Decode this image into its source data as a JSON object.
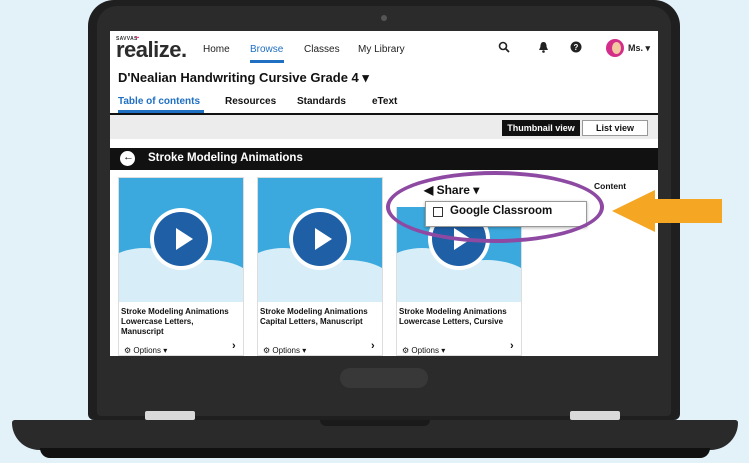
{
  "app": {
    "brand_small": "SAVVAS",
    "brand_dots": "▪▪▪",
    "logo": "realize."
  },
  "nav": {
    "items": [
      {
        "label": "Home"
      },
      {
        "label": "Browse",
        "active": true
      },
      {
        "label": "Classes"
      },
      {
        "label": "My Library"
      }
    ],
    "icons": [
      "search-icon",
      "bell-icon",
      "help-icon"
    ],
    "user": "Ms. ▾"
  },
  "program": {
    "title": "D'Nealian Handwriting Cursive Grade 4 ▾"
  },
  "tabs": [
    {
      "label": "Table of contents",
      "active": true
    },
    {
      "label": "Resources"
    },
    {
      "label": "Standards"
    },
    {
      "label": "eText"
    }
  ],
  "view_toggle": {
    "thumbnail": "Thumbnail view",
    "list": "List view",
    "selected": "thumbnail"
  },
  "section": {
    "back_glyph": "←",
    "title": "Stroke Modeling Animations"
  },
  "cards": [
    {
      "title_line1": "Stroke Modeling Animations",
      "title_line2": "Lowercase Letters,",
      "title_line3": "Manuscript",
      "options": "⚙ Options ▾",
      "chevron": "›"
    },
    {
      "title_line1": "Stroke Modeling Animations",
      "title_line2": "Capital Letters, Manuscript",
      "title_line3": "",
      "options": "⚙ Options ▾",
      "chevron": "›"
    },
    {
      "title_line1": "Stroke Modeling Animations",
      "title_line2": "Lowercase Letters, Cursive",
      "title_line3": "",
      "options": "⚙ Options ▾",
      "chevron": "›"
    }
  ],
  "share": {
    "label": "◀ Share ▾",
    "menu_item": "Google Classroom",
    "partial_label": "Content"
  },
  "colors": {
    "accent": "#1f6fc2",
    "card_image": "#3ba9dd",
    "play_button": "#1f5fa6",
    "highlight": "#8e4aa3",
    "pointer_arrow": "#f5a623"
  }
}
